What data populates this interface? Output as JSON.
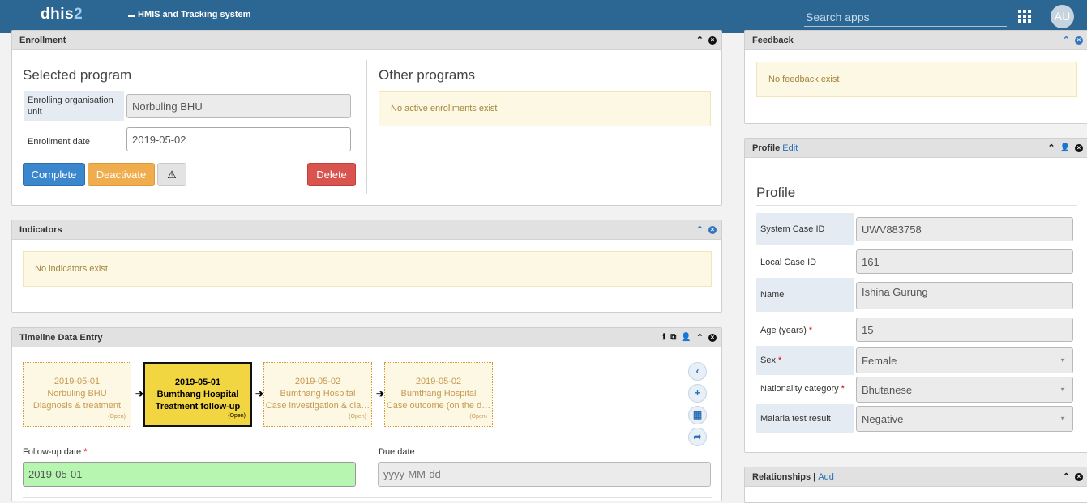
{
  "header": {
    "logo_main": "dhis",
    "logo_num": "2",
    "app_title": "HMIS and Tracking system",
    "search_placeholder": "Search apps",
    "avatar_initials": "AU",
    "colors": {
      "bar": "#2c6693"
    }
  },
  "enrollment": {
    "title": "Enrollment",
    "selected_program_heading": "Selected program",
    "org_unit_label": "Enrolling organisation unit",
    "org_unit_value": "Norbuling BHU",
    "date_label": "Enrollment date",
    "date_value": "2019-05-02",
    "buttons": {
      "complete": "Complete",
      "deactivate": "Deactivate",
      "warning_icon": "⚠",
      "delete": "Delete"
    },
    "other_programs_heading": "Other programs",
    "other_programs_alert": "No active enrollments exist"
  },
  "indicators": {
    "title": "Indicators",
    "alert": "No indicators exist"
  },
  "timeline": {
    "title": "Timeline Data Entry",
    "stages": [
      {
        "date": "2019-05-01",
        "org": "Norbuling BHU",
        "name": "Diagnosis & treatment",
        "status": "(Open)"
      },
      {
        "date": "2019-05-01",
        "org": "Bumthang Hospital",
        "name": "Treatment follow-up",
        "status": "(Open)"
      },
      {
        "date": "2019-05-02",
        "org": "Bumthang Hospital",
        "name": "Case investigation & cla…",
        "status": "(Open)"
      },
      {
        "date": "2019-05-02",
        "org": "Bumthang Hospital",
        "name": "Case outcome (on the d…",
        "status": "(Open)"
      }
    ],
    "followup_label": "Follow-up date",
    "followup_value": "2019-05-01",
    "due_label": "Due date",
    "due_placeholder": "yyyy-MM-dd"
  },
  "feedback": {
    "title": "Feedback",
    "alert": "No feedback exist"
  },
  "profile": {
    "title": "Profile",
    "edit_link": "Edit",
    "heading": "Profile",
    "fields": [
      {
        "label": "System Case ID",
        "value": "UWV883758",
        "required": false
      },
      {
        "label": "Local Case ID",
        "value": "161",
        "required": false
      },
      {
        "label": "Name",
        "value": "Ishina Gurung",
        "required": false
      },
      {
        "label": "Age (years)",
        "value": "15",
        "required": true
      },
      {
        "label": "Sex",
        "value": "Female",
        "required": true
      },
      {
        "label": "Nationality category",
        "value": "Bhutanese",
        "required": true
      },
      {
        "label": "Malaria test result",
        "value": "Negative",
        "required": false
      }
    ]
  },
  "relationships": {
    "title": "Relationships |",
    "add_link": "Add"
  }
}
